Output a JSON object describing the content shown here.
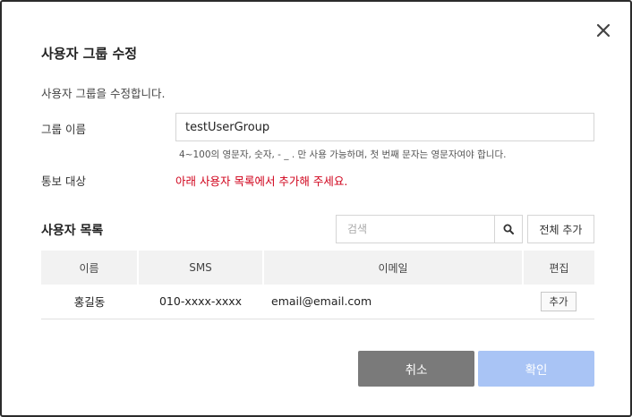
{
  "dialog": {
    "title": "사용자 그룹 수정",
    "description": "사용자 그룹을 수정합니다.",
    "close_icon": "close-icon"
  },
  "form": {
    "group_name_label": "그룹 이름",
    "group_name_value": "testUserGroup",
    "group_name_hint": "4~100의 영문자, 숫자, - _ . 만 사용 가능하며, 첫 번째 문자는 영문자여야 합니다.",
    "notify_label": "통보 대상",
    "notify_message": "아래 사용자 목록에서 추가해 주세요."
  },
  "user_list": {
    "title": "사용자 목록",
    "search_placeholder": "검색",
    "search_icon": "search-icon",
    "add_all_label": "전체 추가",
    "columns": [
      "이름",
      "SMS",
      "이메일",
      "편집"
    ],
    "rows": [
      {
        "name": "홍길동",
        "sms": "010-xxxx-xxxx",
        "email": "email@email.com",
        "action": "추가"
      }
    ]
  },
  "footer": {
    "cancel_label": "취소",
    "confirm_label": "확인"
  },
  "colors": {
    "error_text": "#d0021b",
    "cancel_bg": "#7a7a7a",
    "confirm_bg": "#a9c4f5"
  }
}
